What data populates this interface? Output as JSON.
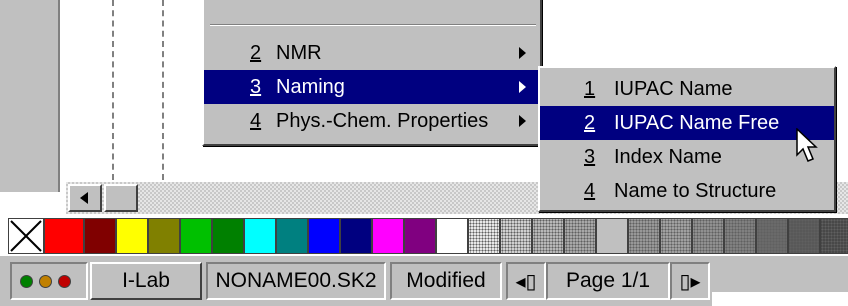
{
  "palette": {
    "colors": [
      "#ff0000",
      "#800000",
      "#ffff00",
      "#808000",
      "#00c000",
      "#008000",
      "#00ffff",
      "#008080",
      "#0000ff",
      "#000080",
      "#ff00ff",
      "#800080",
      "#ffffff",
      "#e8e8e8",
      "#d0d0d0",
      "#b8b8b8",
      "#a8a8a8",
      "#c0c0c0",
      "#989898",
      "#a0a0a0",
      "#909090",
      "#808080",
      "#6a6a6a",
      "#585858",
      "#484848"
    ]
  },
  "context_menu": {
    "items": [
      {
        "number": "2",
        "label": "NMR"
      },
      {
        "number": "3",
        "label": "Naming"
      },
      {
        "number": "4",
        "label": "Phys.-Chem. Properties"
      }
    ]
  },
  "submenu": {
    "items": [
      {
        "number": "1",
        "label": "IUPAC Name"
      },
      {
        "number": "2",
        "label": "IUPAC Name Free"
      },
      {
        "number": "3",
        "label": "Index Name"
      },
      {
        "number": "4",
        "label": "Name to Structure"
      }
    ]
  },
  "status_bar": {
    "lights": [
      "#008000",
      "#c08000",
      "#c00000"
    ],
    "app_label": "I-Lab",
    "filename": "NONAME00.SK2",
    "doc_status": "Modified",
    "page_label": "Page 1/1"
  }
}
